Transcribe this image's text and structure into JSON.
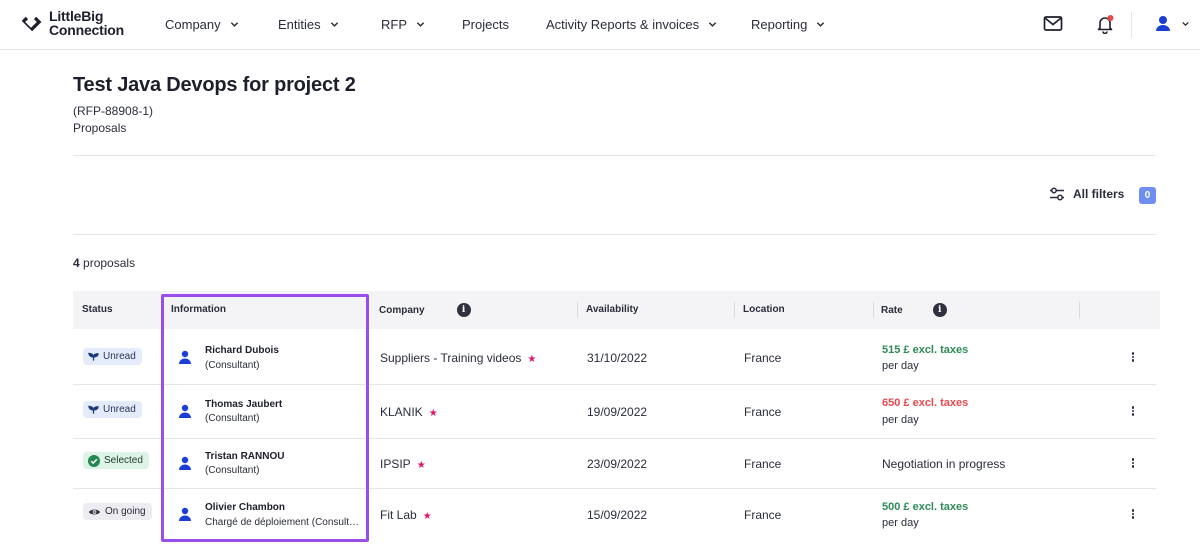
{
  "app": {
    "logo_line1": "LittleBig",
    "logo_line2": "Connection"
  },
  "nav": {
    "items": [
      {
        "label": "Company",
        "has_dropdown": true
      },
      {
        "label": "Entities",
        "has_dropdown": true
      },
      {
        "label": "RFP",
        "has_dropdown": true
      },
      {
        "label": "Projects",
        "has_dropdown": false
      },
      {
        "label": "Activity Reports & invoices",
        "has_dropdown": true
      },
      {
        "label": "Reporting",
        "has_dropdown": true
      }
    ],
    "icons": [
      "mail-icon",
      "bell-icon",
      "user-icon"
    ]
  },
  "page": {
    "title": "Test Java Devops for project 2",
    "reference": "(RFP-88908-1)",
    "subtitle": "Proposals"
  },
  "filters": {
    "label": "All filters",
    "count": "0"
  },
  "summary": {
    "count": "4",
    "label": "proposals"
  },
  "table": {
    "headers": {
      "status": "Status",
      "information": "Information",
      "company": "Company",
      "availability": "Availability",
      "location": "Location",
      "rate": "Rate"
    },
    "rows": [
      {
        "status": "Unread",
        "status_kind": "unread",
        "name": "Richard Dubois",
        "role": "(Consultant)",
        "company": "Suppliers - Training videos",
        "availability": "31/10/2022",
        "location": "France",
        "rate": "515 £ excl. taxes",
        "rate_color": "green",
        "rate_unit": "per day"
      },
      {
        "status": "Unread",
        "status_kind": "unread",
        "name": "Thomas Jaubert",
        "role": "(Consultant)",
        "company": "KLANIK",
        "availability": "19/09/2022",
        "location": "France",
        "rate": "650 £ excl. taxes",
        "rate_color": "red",
        "rate_unit": "per day"
      },
      {
        "status": "Selected",
        "status_kind": "selected",
        "name": "Tristan RANNOU",
        "role": "(Consultant)",
        "company": "IPSIP",
        "availability": "23/09/2022",
        "location": "France",
        "rate_text": "Negotiation in progress"
      },
      {
        "status": "On going",
        "status_kind": "ongoing",
        "name": "Olivier Chambon",
        "role": "Chargé de déploiement (Consultant)",
        "company": "Fit Lab",
        "availability": "15/09/2022",
        "location": "France",
        "rate": "500 £ excl. taxes",
        "rate_color": "green",
        "rate_unit": "per day"
      }
    ]
  },
  "colors": {
    "accent_blue": "#1b3fd6",
    "highlight_purple": "#9b4dec",
    "rate_green": "#2e8b57",
    "rate_red": "#e5484d",
    "star_pink": "#e0186c",
    "filter_badge": "#6f8ff0"
  }
}
